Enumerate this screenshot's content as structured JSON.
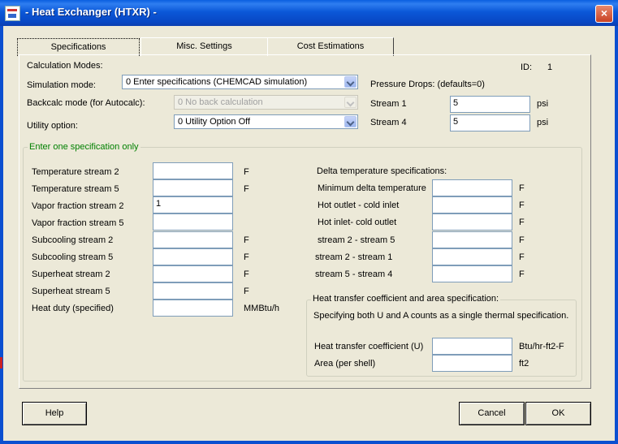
{
  "window": {
    "title": "- Heat Exchanger (HTXR) -",
    "close_icon": "×"
  },
  "tabs": [
    {
      "label": "Specifications",
      "active": true
    },
    {
      "label": "Misc. Settings",
      "active": false
    },
    {
      "label": "Cost Estimations",
      "active": false
    }
  ],
  "top": {
    "calc_modes_label": "Calculation Modes:",
    "id_label": "ID:",
    "id_value": "1",
    "simulation_mode": {
      "label": "Simulation mode:",
      "value": "0 Enter specifications (CHEMCAD simulation)"
    },
    "backcalc_mode": {
      "label": "Backcalc mode (for Autocalc):",
      "value": "0 No back calculation"
    },
    "utility_option": {
      "label": "Utility option:",
      "value": "0 Utility Option Off"
    },
    "pressure_drops_label": "Pressure Drops:  (defaults=0)",
    "stream1": {
      "label": "Stream  1",
      "value": "5",
      "unit": "psi"
    },
    "stream4": {
      "label": "Stream  4",
      "value": "5",
      "unit": "psi"
    }
  },
  "spec_group": {
    "title": "Enter one specification only",
    "rows": [
      {
        "label": "Temperature stream    2",
        "value": "",
        "unit": "F"
      },
      {
        "label": "Temperature stream  5",
        "value": "",
        "unit": "F"
      },
      {
        "label": "Vapor fraction stream  2",
        "value": "1",
        "unit": ""
      },
      {
        "label": "Vapor fraction stream  5",
        "value": "",
        "unit": ""
      },
      {
        "label": "Subcooling stream  2",
        "value": "",
        "unit": "F"
      },
      {
        "label": "Subcooling stream  5",
        "value": "",
        "unit": "F"
      },
      {
        "label": "Superheat stream  2",
        "value": "",
        "unit": "F"
      },
      {
        "label": "Superheat stream  5",
        "value": "",
        "unit": "F"
      },
      {
        "label": "Heat duty (specified)",
        "value": "",
        "unit": "MMBtu/h"
      }
    ],
    "delta_title": "Delta temperature specifications:",
    "delta_rows": [
      {
        "label": "Minimum delta temperature",
        "value": "",
        "unit": "F"
      },
      {
        "label": "Hot outlet - cold inlet",
        "value": "",
        "unit": "F"
      },
      {
        "label": "Hot inlet- cold outlet",
        "value": "",
        "unit": "F"
      },
      {
        "label": " stream 2 - stream 5",
        "value": "",
        "unit": "F"
      },
      {
        "label": "stream 2 - stream 1",
        "value": "",
        "unit": "F"
      },
      {
        "label": "stream 5 - stream 4",
        "value": "",
        "unit": "F"
      }
    ],
    "ua": {
      "title": "Heat transfer coefficient and  area specification:",
      "note": "Specifying both U and A counts as a single thermal specification.",
      "u": {
        "label": "Heat transfer coefficient  (U)",
        "value": "",
        "unit": "Btu/hr-ft2-F"
      },
      "a": {
        "label": "Area (per shell)",
        "value": "",
        "unit": "ft2"
      }
    }
  },
  "buttons": {
    "help": "Help",
    "cancel": "Cancel",
    "ok": "OK"
  }
}
